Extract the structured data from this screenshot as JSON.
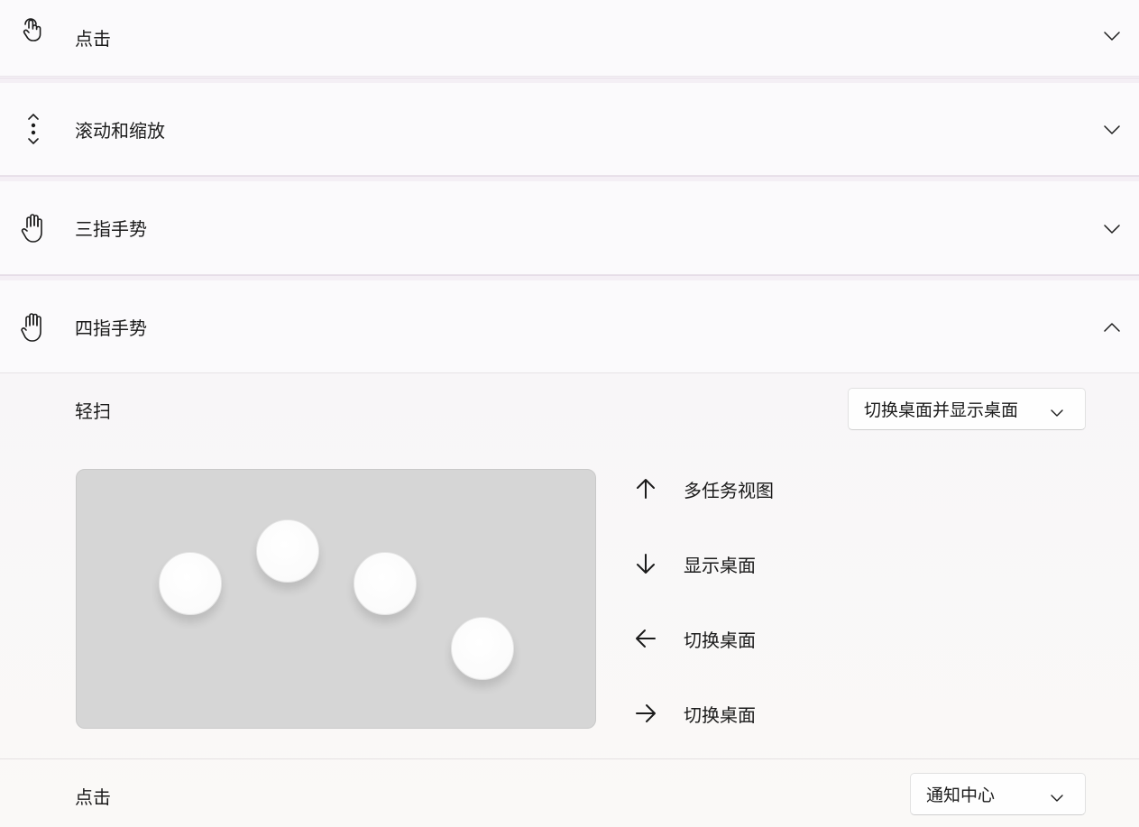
{
  "sections": [
    {
      "label": "点击",
      "icon": "tap-icon",
      "expanded": false
    },
    {
      "label": "滚动和缩放",
      "icon": "scroll-zoom-icon",
      "expanded": false
    },
    {
      "label": "三指手势",
      "icon": "three-finger-hand-icon",
      "expanded": false
    },
    {
      "label": "四指手势",
      "icon": "four-finger-hand-icon",
      "expanded": true
    }
  ],
  "four_finger": {
    "swipe": {
      "label": "轻扫",
      "selected": "切换桌面并显示桌面"
    },
    "gestures": [
      {
        "direction": "up",
        "icon": "arrow-up-icon",
        "label": "多任务视图"
      },
      {
        "direction": "down",
        "icon": "arrow-down-icon",
        "label": "显示桌面"
      },
      {
        "direction": "left",
        "icon": "arrow-left-icon",
        "label": "切换桌面"
      },
      {
        "direction": "right",
        "icon": "arrow-right-icon",
        "label": "切换桌面"
      }
    ],
    "tap": {
      "label": "点击",
      "selected": "通知中心"
    }
  }
}
